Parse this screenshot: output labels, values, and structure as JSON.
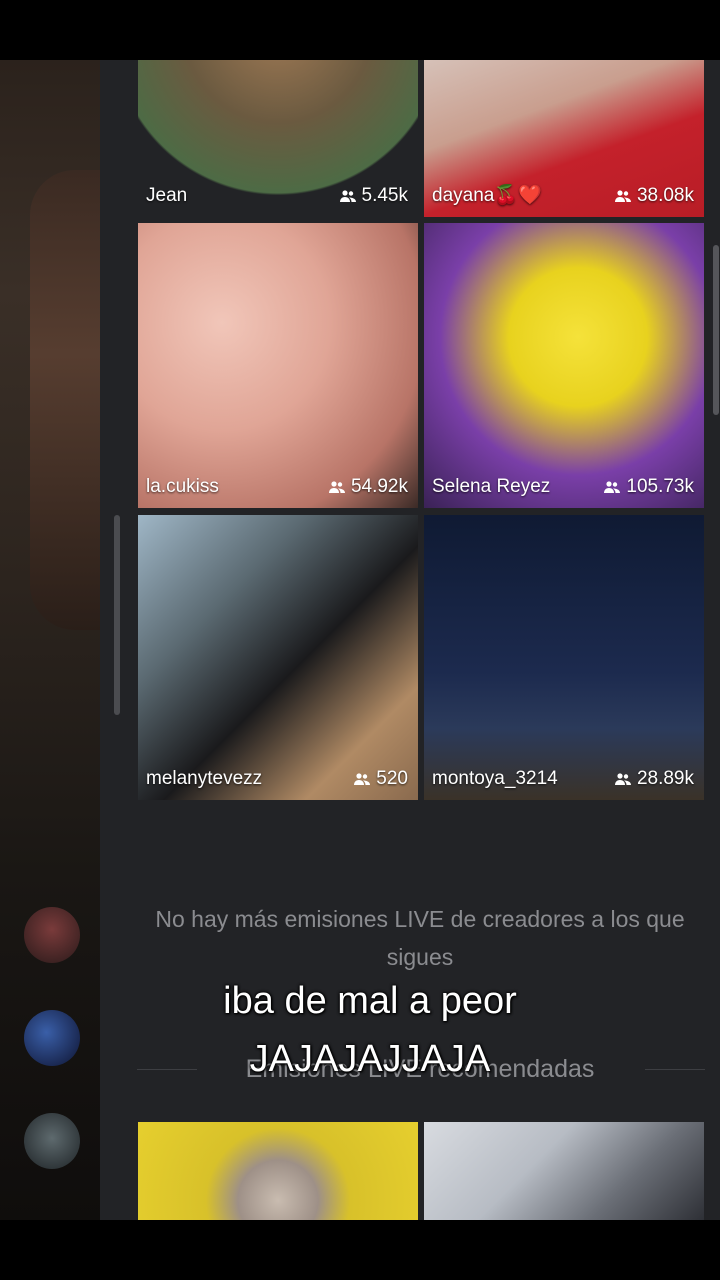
{
  "grid": [
    {
      "name": "Jean",
      "viewers": "5.45k"
    },
    {
      "name": "dayana🍒❤️",
      "viewers": "38.08k"
    },
    {
      "name": "la.cukiss",
      "viewers": "54.92k"
    },
    {
      "name": "Selena Reyez",
      "viewers": "105.73k"
    },
    {
      "name": "melanytevezz",
      "viewers": "520"
    },
    {
      "name": "montoya_3214",
      "viewers": "28.89k"
    }
  ],
  "empty_message": "No hay más emisiones LIVE de creadores a los que sigues",
  "section_title": "Emisiones LIVE recomendadas",
  "caption_line1": "iba de mal a peor",
  "caption_line2": "JAJAJAJJAJA",
  "colors": {
    "panel": "#222326",
    "text_muted": "#8b8c90",
    "caption": "#ffffff"
  }
}
